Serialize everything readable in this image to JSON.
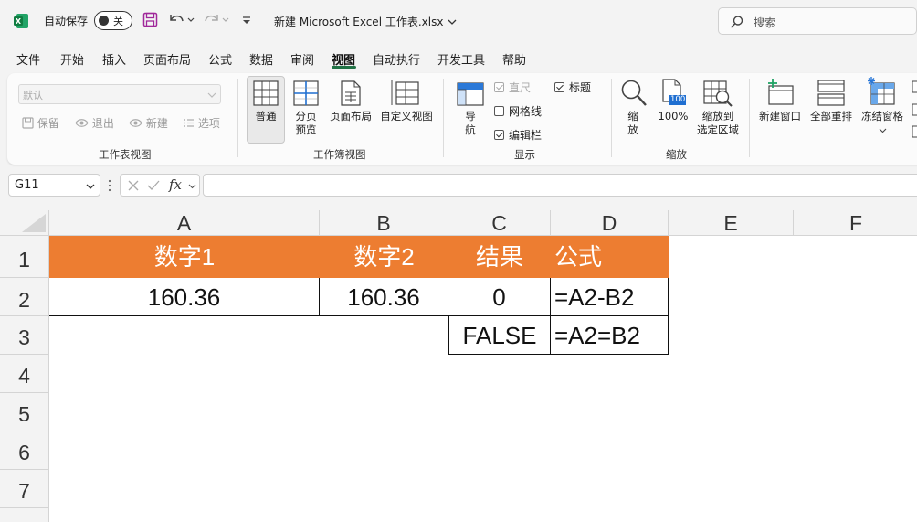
{
  "titlebar": {
    "autosave_label": "自动保存",
    "autosave_state": "关",
    "doc_title": "新建 Microsoft Excel 工作表.xlsx",
    "search_placeholder": "搜索"
  },
  "menu": {
    "tabs": [
      "文件",
      "开始",
      "插入",
      "页面布局",
      "公式",
      "数据",
      "审阅",
      "视图",
      "自动执行",
      "开发工具",
      "帮助"
    ],
    "active_tab": "视图"
  },
  "ribbon": {
    "sheet_view": {
      "select_placeholder": "默认",
      "keep": "保留",
      "exit": "退出",
      "new": "新建",
      "options": "选项",
      "label": "工作表视图"
    },
    "workbook_view": {
      "normal": "普通",
      "page_break_1": "分页",
      "page_break_2": "预览",
      "page_layout": "页面布局",
      "custom": "自定义视图",
      "label": "工作簿视图"
    },
    "show": {
      "nav_1": "导",
      "nav_2": "航",
      "ruler": "直尺",
      "gridlines": "网格线",
      "formula_bar": "编辑栏",
      "headings": "标题",
      "label": "显示"
    },
    "zoom": {
      "zoom_1": "缩",
      "zoom_2": "放",
      "zoom_100_badge": "100",
      "zoom_100": "100%",
      "zoom_sel_1": "缩放到",
      "zoom_sel_2": "选定区域",
      "label": "缩放"
    },
    "window": {
      "new_window": "新建窗口",
      "arrange_all": "全部重排",
      "freeze": "冻结窗格"
    }
  },
  "formula_bar": {
    "name_box": "G11",
    "fx": "fx",
    "formula": ""
  },
  "sheet": {
    "columns": [
      "A",
      "B",
      "C",
      "D",
      "E",
      "F"
    ],
    "rows": [
      "1",
      "2",
      "3",
      "4",
      "5",
      "6",
      "7"
    ],
    "cells": {
      "A1": "数字1",
      "B1": "数字2",
      "C1": "结果",
      "D1": "公式",
      "A2": "160.36",
      "B2": "160.36",
      "C2": "0",
      "D2": "=A2-B2",
      "C3": "FALSE",
      "D3": "=A2=B2"
    }
  },
  "colors": {
    "header_fill": "#ed7d31",
    "accent": "#217346"
  }
}
